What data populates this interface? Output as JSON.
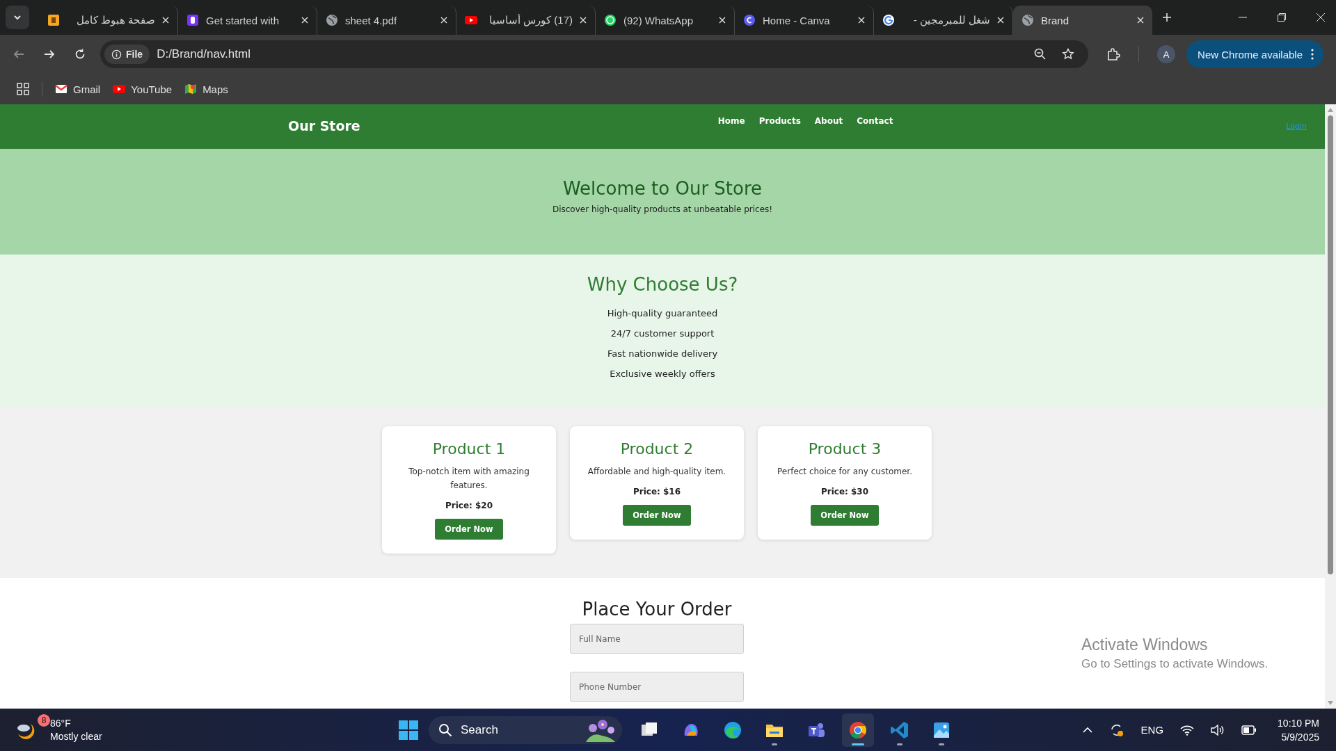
{
  "tabs": [
    {
      "kind": "orange",
      "title": "صفحة هبوط كامل",
      "selected": false
    },
    {
      "kind": "bootstrap",
      "title": "Get started with",
      "selected": false
    },
    {
      "kind": "globe",
      "title": "sheet 4.pdf",
      "selected": false
    },
    {
      "kind": "youtube",
      "title": "(17) كورس أساسيا",
      "selected": false
    },
    {
      "kind": "whatsapp",
      "title": "(92) WhatsApp",
      "selected": false
    },
    {
      "kind": "canva",
      "title": "Home - Canva",
      "selected": false
    },
    {
      "kind": "google",
      "title": "شغل للمبرمجين -",
      "selected": false
    },
    {
      "kind": "globe",
      "title": "Brand",
      "selected": true
    }
  ],
  "address": {
    "scheme": "File",
    "url": "D:/Brand/nav.html"
  },
  "profile": "A",
  "update_button": "New Chrome available",
  "bookmarks": [
    {
      "kind": "gmail",
      "label": "Gmail"
    },
    {
      "kind": "youtube",
      "label": "YouTube"
    },
    {
      "kind": "maps",
      "label": "Maps"
    }
  ],
  "site": {
    "brand": "Our Store",
    "nav": [
      "Home",
      "Products",
      "About",
      "Contact"
    ],
    "login": "Login",
    "hero": {
      "title": "Welcome to Our Store",
      "subtitle": "Discover high-quality products at unbeatable prices!"
    },
    "why": {
      "title": "Why Choose Us?",
      "items": [
        "High-quality guaranteed",
        "24/7 customer support",
        "Fast nationwide delivery",
        "Exclusive weekly offers"
      ]
    },
    "products": [
      {
        "name": "Product 1",
        "description": "Top-notch item with amazing features.",
        "price": "Price: $20",
        "button": "Order Now"
      },
      {
        "name": "Product 2",
        "description": "Affordable and high-quality item.",
        "price": "Price: $16",
        "button": "Order Now"
      },
      {
        "name": "Product 3",
        "description": "Perfect choice for any customer.",
        "price": "Price: $30",
        "button": "Order Now"
      }
    ],
    "order": {
      "title": "Place Your Order",
      "fields": [
        {
          "placeholder": "Full Name"
        },
        {
          "placeholder": "Phone Number"
        }
      ]
    }
  },
  "activation": {
    "title": "Activate Windows",
    "subtitle": "Go to Settings to activate Windows."
  },
  "taskbar": {
    "weather": {
      "badge": "8",
      "temperature": "86°F",
      "condition": "Mostly clear"
    },
    "search": "Search",
    "apps": [
      {
        "kind": "taskview",
        "open": false,
        "selected": false
      },
      {
        "kind": "copilot",
        "open": false,
        "selected": false
      },
      {
        "kind": "edge",
        "open": false,
        "selected": false
      },
      {
        "kind": "explorer",
        "open": true,
        "selected": false
      },
      {
        "kind": "teams",
        "open": false,
        "selected": false
      },
      {
        "kind": "chrome",
        "open": true,
        "selected": true
      },
      {
        "kind": "vscode",
        "open": true,
        "selected": false
      },
      {
        "kind": "photos",
        "open": true,
        "selected": false
      }
    ],
    "language": "ENG",
    "time": "10:10 PM",
    "date": "5/9/2025"
  }
}
